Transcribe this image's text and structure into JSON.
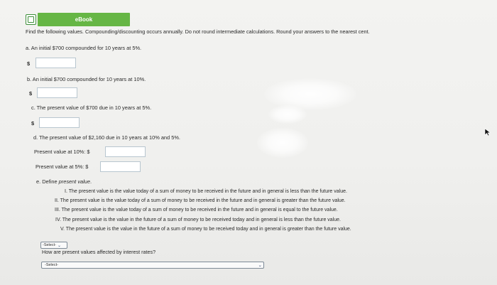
{
  "header": {
    "ebook_label": "eBook",
    "ebook_icon": "book-icon"
  },
  "instructions": "Find the following values. Compounding/discounting occurs annually. Do not round intermediate calculations. Round your answers to the nearest cent.",
  "parts": {
    "a": {
      "prompt": "a. An initial $700 compounded for 10 years at 5%.",
      "currency": "$",
      "value": ""
    },
    "b": {
      "prompt": "b. An initial $700 compounded for 10 years at 10%.",
      "currency": "$",
      "value": ""
    },
    "c": {
      "prompt": "c. The present value of $700 due in 10 years at 5%.",
      "currency": "$",
      "value": ""
    },
    "d": {
      "prompt": "d. The present value of $2,160 due in 10 years at 10% and 5%.",
      "pv10_label": "Present value at 10%: $",
      "pv5_label": "Present value at 5%: $",
      "pv10_value": "",
      "pv5_value": ""
    },
    "e": {
      "prompt_prefix": "e. Define",
      "prompt_term": "present value",
      "prompt_suffix": ".",
      "options": [
        "I. The present value is the value today of a sum of money to be received in the future and in general is less than the future value.",
        "II. The present value is the value today of a sum of money to be received in the future and in general is greater than the future value.",
        "III. The present value is the value today of a sum of money to be received in the future and in general is equal to the future value.",
        "IV. The present value is the value in the future of a sum of money to be received today and in general is less than the future value.",
        "V. The present value is the value in the future of a sum of money to be received today and in general is greater than the future value."
      ],
      "select_value": "-Select-",
      "question2": "How are present values affected by interest rates?",
      "select2_value": "-Select-"
    }
  },
  "colors": {
    "ebook_green": "#66b645",
    "field_border": "#b8c6cf"
  }
}
